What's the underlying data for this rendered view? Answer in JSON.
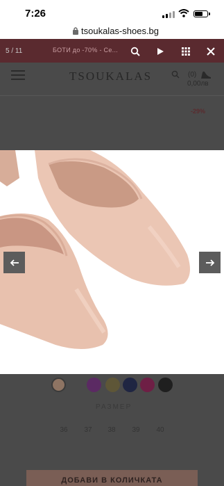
{
  "status_bar": {
    "time": "7:26"
  },
  "browser": {
    "url": "tsoukalas-shoes.bg"
  },
  "promo": {
    "text": "БОТИ до -70% - Се..."
  },
  "gallery": {
    "counter": "5 / 11",
    "tools": [
      "search-icon",
      "play-icon",
      "grid-icon",
      "close-icon"
    ]
  },
  "header": {
    "logo": "TSOUKALAS",
    "cart_count": "(0)",
    "cart_total": "0,00лв"
  },
  "product": {
    "discount": "-29%"
  },
  "colors": {
    "swatches": [
      "#8e7463",
      "#5b2a63",
      "#5e5637",
      "#1f2542",
      "#6e1f45",
      "#1f1f1f"
    ],
    "selected": 0
  },
  "size": {
    "label": "РАЗМЕР",
    "options": [
      "36",
      "37",
      "38",
      "39",
      "40"
    ]
  },
  "cta": {
    "label": "ДОБАВИ В КОЛИЧКАТА"
  }
}
